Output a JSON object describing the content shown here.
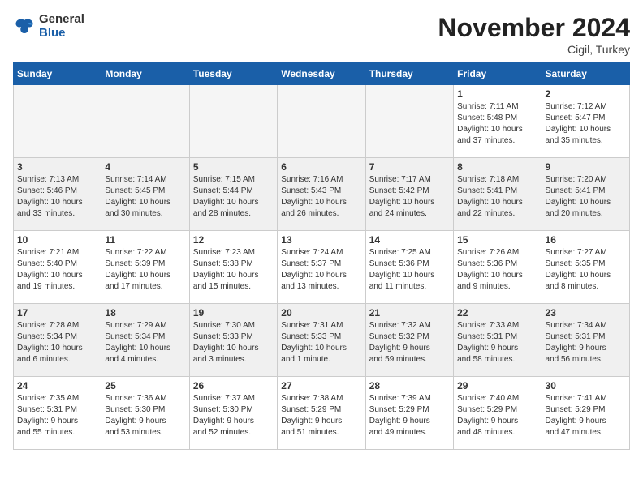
{
  "header": {
    "logo_general": "General",
    "logo_blue": "Blue",
    "month_title": "November 2024",
    "location": "Cigil, Turkey"
  },
  "weekdays": [
    "Sunday",
    "Monday",
    "Tuesday",
    "Wednesday",
    "Thursday",
    "Friday",
    "Saturday"
  ],
  "weeks": [
    [
      {
        "day": "",
        "info": ""
      },
      {
        "day": "",
        "info": ""
      },
      {
        "day": "",
        "info": ""
      },
      {
        "day": "",
        "info": ""
      },
      {
        "day": "",
        "info": ""
      },
      {
        "day": "1",
        "info": "Sunrise: 7:11 AM\nSunset: 5:48 PM\nDaylight: 10 hours\nand 37 minutes."
      },
      {
        "day": "2",
        "info": "Sunrise: 7:12 AM\nSunset: 5:47 PM\nDaylight: 10 hours\nand 35 minutes."
      }
    ],
    [
      {
        "day": "3",
        "info": "Sunrise: 7:13 AM\nSunset: 5:46 PM\nDaylight: 10 hours\nand 33 minutes."
      },
      {
        "day": "4",
        "info": "Sunrise: 7:14 AM\nSunset: 5:45 PM\nDaylight: 10 hours\nand 30 minutes."
      },
      {
        "day": "5",
        "info": "Sunrise: 7:15 AM\nSunset: 5:44 PM\nDaylight: 10 hours\nand 28 minutes."
      },
      {
        "day": "6",
        "info": "Sunrise: 7:16 AM\nSunset: 5:43 PM\nDaylight: 10 hours\nand 26 minutes."
      },
      {
        "day": "7",
        "info": "Sunrise: 7:17 AM\nSunset: 5:42 PM\nDaylight: 10 hours\nand 24 minutes."
      },
      {
        "day": "8",
        "info": "Sunrise: 7:18 AM\nSunset: 5:41 PM\nDaylight: 10 hours\nand 22 minutes."
      },
      {
        "day": "9",
        "info": "Sunrise: 7:20 AM\nSunset: 5:41 PM\nDaylight: 10 hours\nand 20 minutes."
      }
    ],
    [
      {
        "day": "10",
        "info": "Sunrise: 7:21 AM\nSunset: 5:40 PM\nDaylight: 10 hours\nand 19 minutes."
      },
      {
        "day": "11",
        "info": "Sunrise: 7:22 AM\nSunset: 5:39 PM\nDaylight: 10 hours\nand 17 minutes."
      },
      {
        "day": "12",
        "info": "Sunrise: 7:23 AM\nSunset: 5:38 PM\nDaylight: 10 hours\nand 15 minutes."
      },
      {
        "day": "13",
        "info": "Sunrise: 7:24 AM\nSunset: 5:37 PM\nDaylight: 10 hours\nand 13 minutes."
      },
      {
        "day": "14",
        "info": "Sunrise: 7:25 AM\nSunset: 5:36 PM\nDaylight: 10 hours\nand 11 minutes."
      },
      {
        "day": "15",
        "info": "Sunrise: 7:26 AM\nSunset: 5:36 PM\nDaylight: 10 hours\nand 9 minutes."
      },
      {
        "day": "16",
        "info": "Sunrise: 7:27 AM\nSunset: 5:35 PM\nDaylight: 10 hours\nand 8 minutes."
      }
    ],
    [
      {
        "day": "17",
        "info": "Sunrise: 7:28 AM\nSunset: 5:34 PM\nDaylight: 10 hours\nand 6 minutes."
      },
      {
        "day": "18",
        "info": "Sunrise: 7:29 AM\nSunset: 5:34 PM\nDaylight: 10 hours\nand 4 minutes."
      },
      {
        "day": "19",
        "info": "Sunrise: 7:30 AM\nSunset: 5:33 PM\nDaylight: 10 hours\nand 3 minutes."
      },
      {
        "day": "20",
        "info": "Sunrise: 7:31 AM\nSunset: 5:33 PM\nDaylight: 10 hours\nand 1 minute."
      },
      {
        "day": "21",
        "info": "Sunrise: 7:32 AM\nSunset: 5:32 PM\nDaylight: 9 hours\nand 59 minutes."
      },
      {
        "day": "22",
        "info": "Sunrise: 7:33 AM\nSunset: 5:31 PM\nDaylight: 9 hours\nand 58 minutes."
      },
      {
        "day": "23",
        "info": "Sunrise: 7:34 AM\nSunset: 5:31 PM\nDaylight: 9 hours\nand 56 minutes."
      }
    ],
    [
      {
        "day": "24",
        "info": "Sunrise: 7:35 AM\nSunset: 5:31 PM\nDaylight: 9 hours\nand 55 minutes."
      },
      {
        "day": "25",
        "info": "Sunrise: 7:36 AM\nSunset: 5:30 PM\nDaylight: 9 hours\nand 53 minutes."
      },
      {
        "day": "26",
        "info": "Sunrise: 7:37 AM\nSunset: 5:30 PM\nDaylight: 9 hours\nand 52 minutes."
      },
      {
        "day": "27",
        "info": "Sunrise: 7:38 AM\nSunset: 5:29 PM\nDaylight: 9 hours\nand 51 minutes."
      },
      {
        "day": "28",
        "info": "Sunrise: 7:39 AM\nSunset: 5:29 PM\nDaylight: 9 hours\nand 49 minutes."
      },
      {
        "day": "29",
        "info": "Sunrise: 7:40 AM\nSunset: 5:29 PM\nDaylight: 9 hours\nand 48 minutes."
      },
      {
        "day": "30",
        "info": "Sunrise: 7:41 AM\nSunset: 5:29 PM\nDaylight: 9 hours\nand 47 minutes."
      }
    ]
  ]
}
